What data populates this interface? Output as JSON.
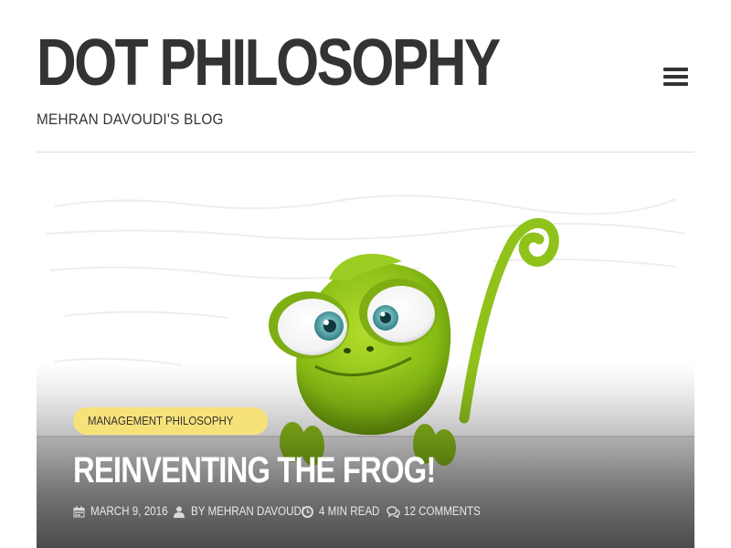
{
  "site": {
    "title": "DOT PHILOSOPHY",
    "tagline": "MEHRAN DAVOUDI'S BLOG",
    "menu_icon": "hamburger-menu-icon"
  },
  "featured_post": {
    "category": "MANAGEMENT PHILOSOPHY",
    "title": "REINVENTING THE FROG!",
    "image_subject": "cartoon green chameleon peeking over a ledge",
    "meta": {
      "date": "MARCH 9, 2016",
      "author": "BY MEHRAN DAVOUDI",
      "read_time": "4 MIN READ",
      "comments": "12 COMMENTS"
    },
    "meta_icons": [
      "calendar-icon",
      "user-icon",
      "clock-icon",
      "comments-icon"
    ]
  },
  "colors": {
    "text": "#333333",
    "badge": "#f7e27a",
    "frog_green": "#8fc21b",
    "overlay_text": "#ffffff"
  }
}
